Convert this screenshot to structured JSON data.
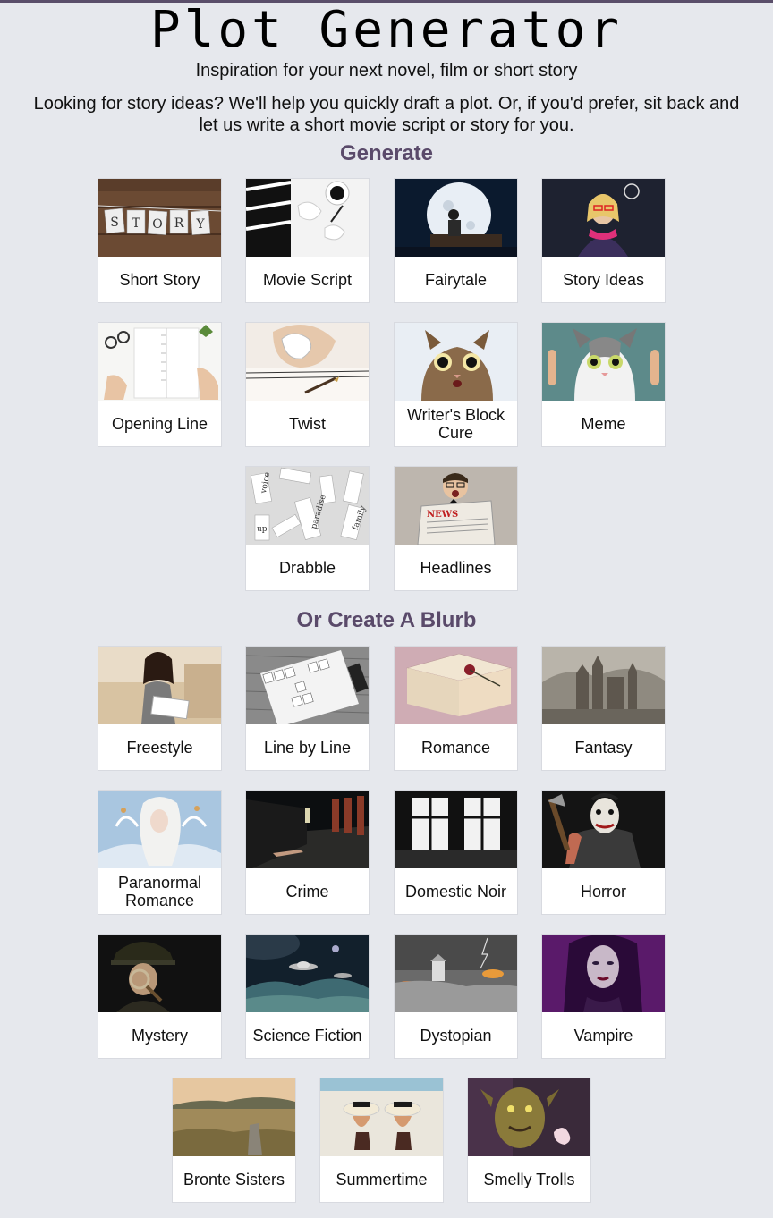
{
  "header": {
    "title": "Plot Generator",
    "subtitle": "Inspiration for your next novel, film or short story",
    "intro": "Looking for story ideas? We'll help you quickly draft a plot. Or, if you'd prefer, sit back and let us write a short movie script or story for you."
  },
  "generate": {
    "heading": "Generate",
    "items": [
      {
        "label": "Short Story",
        "icon": "story-letters-image"
      },
      {
        "label": "Movie Script",
        "icon": "clapperboard-image"
      },
      {
        "label": "Fairytale",
        "icon": "moon-reader-image"
      },
      {
        "label": "Story Ideas",
        "icon": "lightbulb-woman-image"
      },
      {
        "label": "Opening Line",
        "icon": "notebook-writing-image"
      },
      {
        "label": "Twist",
        "icon": "crumpled-paper-image"
      },
      {
        "label": "Writer's Block Cure",
        "icon": "surprised-cat-image"
      },
      {
        "label": "Meme",
        "icon": "cat-meme-image"
      },
      {
        "label": "Drabble",
        "icon": "word-cards-image"
      },
      {
        "label": "Headlines",
        "icon": "newspaper-man-image"
      }
    ]
  },
  "blurb": {
    "heading": "Or Create A Blurb",
    "items": [
      {
        "label": "Freestyle",
        "icon": "woman-writing-image"
      },
      {
        "label": "Line by Line",
        "icon": "once-upon-a-time-tiles-image"
      },
      {
        "label": "Romance",
        "icon": "book-rose-image"
      },
      {
        "label": "Fantasy",
        "icon": "castle-image"
      },
      {
        "label": "Paranormal Romance",
        "icon": "ethereal-woman-image"
      },
      {
        "label": "Crime",
        "icon": "corridor-body-image"
      },
      {
        "label": "Domestic Noir",
        "icon": "dark-window-image"
      },
      {
        "label": "Horror",
        "icon": "clown-axe-image"
      },
      {
        "label": "Mystery",
        "icon": "detective-magnifier-image"
      },
      {
        "label": "Science Fiction",
        "icon": "ufo-planet-image"
      },
      {
        "label": "Dystopian",
        "icon": "stormy-landscape-image"
      },
      {
        "label": "Vampire",
        "icon": "vampire-woman-image"
      },
      {
        "label": "Bronte Sisters",
        "icon": "moorland-image"
      },
      {
        "label": "Summertime",
        "icon": "beach-hats-image"
      },
      {
        "label": "Smelly Trolls",
        "icon": "troll-image"
      }
    ]
  },
  "colors": {
    "background": "#e6e8ed",
    "heading": "#5a4a6a",
    "card": "#ffffff"
  }
}
